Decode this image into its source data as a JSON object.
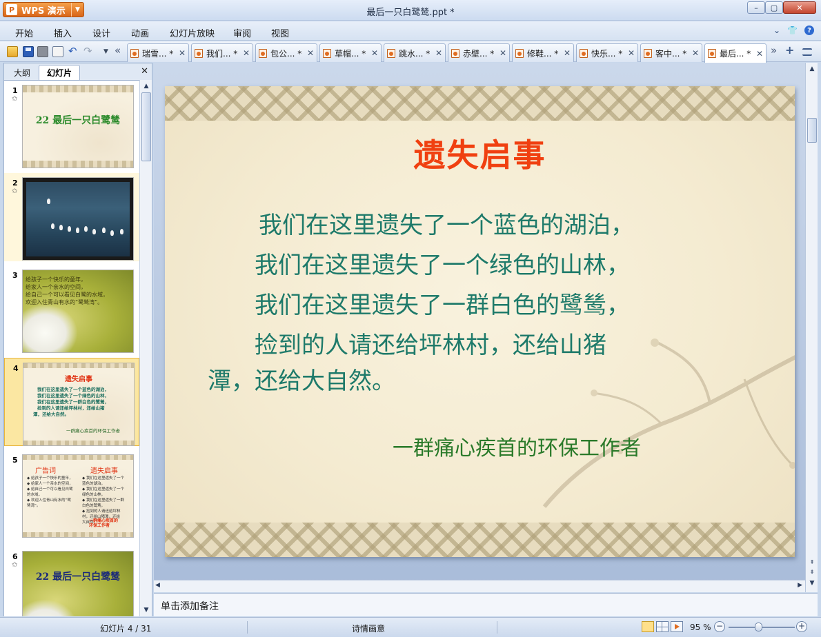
{
  "app": {
    "name": "WPS 演示",
    "logo_glyph": "P",
    "window_title": "最后一只白鹭鸶.ppt *"
  },
  "window_controls": {
    "minimize": "–",
    "maximize": "▢",
    "close": "✕"
  },
  "menu": {
    "items": [
      "开始",
      "插入",
      "设计",
      "动画",
      "幻灯片放映",
      "审阅",
      "视图"
    ],
    "right_chevron": "⌄",
    "right_shirt": "👕",
    "right_help": "?"
  },
  "toolbar": {
    "undo": "↶",
    "redo": "↷",
    "dropdown": "▼",
    "tabs_prev": "«",
    "tabs_next": "»",
    "new_tab": "+"
  },
  "doc_tabs": [
    {
      "label": "瑞雪... *",
      "close": "✕"
    },
    {
      "label": "我们... *",
      "close": "✕"
    },
    {
      "label": "包公... *",
      "close": "✕"
    },
    {
      "label": "草帽... *",
      "close": "✕"
    },
    {
      "label": "跳水... *",
      "close": "✕"
    },
    {
      "label": "赤壁... *",
      "close": "✕"
    },
    {
      "label": "修鞋... *",
      "close": "✕"
    },
    {
      "label": "快乐... *",
      "close": "✕"
    },
    {
      "label": "客中... *",
      "close": "✕"
    },
    {
      "label": "最后... *",
      "close": "✕"
    }
  ],
  "left_panel": {
    "tab_outline": "大纲",
    "tab_slides": "幻灯片",
    "close": "✕",
    "scroll_up": "▲",
    "scroll_down": "▼",
    "slides": [
      {
        "num": "1",
        "star": "✩",
        "title": "22 最后一只白鹭鸶"
      },
      {
        "num": "2",
        "star": "✩"
      },
      {
        "num": "3",
        "lines": [
          "给孩子一个快乐的童年，",
          "给家人一个亲水的空间，",
          "给自己一个可以看见白鹭的水域，",
          "欢迎入住青山有水的“鹭鸶湾”。"
        ]
      },
      {
        "num": "4",
        "title": "遗失启事",
        "lines": [
          "我们在这里遗失了一个蓝色的湖泊，",
          "我们在这里遗失了一个绿色的山林，",
          "我们在这里遗失了一群白色的鹭鸶，",
          "捡到的人请还给坪林村，还给山猪",
          "潭，还给大自然。"
        ],
        "sign": "一群痛心疾首的环保工作者"
      },
      {
        "num": "5",
        "left_title": "广告词",
        "right_title": "遗失启事",
        "left_lines": [
          "◆ 给孩子一个快乐的童年，",
          "◆ 给家人一个亲水的空间，",
          "◆ 给自己一个可以看见白鹭",
          "   的水域，",
          "◆ 欢迎入住青山有水的“鹭",
          "   鸶湾”。"
        ],
        "right_lines": [
          "◆ 我们在这里遗失了一个",
          "   蓝色的湖泊，",
          "◆ 我们在这里遗失了一个",
          "   绿色的山林，",
          "◆ 我们在这里遗失了一群",
          "   白色的鹭鸶，",
          "◆ 捡到的人请还给坪林",
          "   村，还给山猪潭，还给",
          "   大自然。"
        ],
        "foot": [
          "一群痛心疾首的",
          "环保工作者"
        ]
      },
      {
        "num": "6",
        "star": "✩",
        "title": "22 最后一只白鹭鸶"
      }
    ]
  },
  "slide": {
    "heading": "遗失启事",
    "lines": [
      "我们在这里遗失了一个蓝色的湖泊，",
      "我们在这里遗失了一个绿色的山林，",
      "我们在这里遗失了一群白色的鹭鸶，",
      "捡到的人请还给坪林村，还给山猪",
      "潭，还给大自然。"
    ],
    "signature": "一群痛心疾首的环保工作者"
  },
  "scroll": {
    "up": "▲",
    "down": "▼",
    "left": "◀",
    "right": "▶",
    "pgup": "⇞",
    "pgdn": "⇟"
  },
  "notes": {
    "placeholder": "单击添加备注"
  },
  "status": {
    "slide_info": "幻灯片 4 / 31",
    "theme": "诗情画意",
    "zoom": "95 %",
    "zoom_out": "−",
    "zoom_in": "+",
    "zoom_level": 0.45
  }
}
